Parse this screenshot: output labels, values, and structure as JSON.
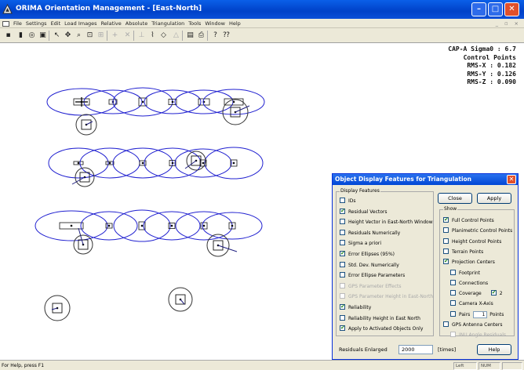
{
  "window": {
    "title": "ORIMA Orientation Management - [East-North]",
    "colors": {
      "titlebar": "#0054e3",
      "ellipse": "#2020d0",
      "vector": "#202080"
    }
  },
  "menu": [
    "File",
    "Settings",
    "Edit",
    "Load Images",
    "Relative",
    "Absolute",
    "Triangulation",
    "Tools",
    "Window",
    "Help"
  ],
  "mdi_controls": "_ ▫ ×",
  "toolbar": {
    "icons": [
      "save-icon",
      "stats-icon",
      "settings-icon",
      "frame-icon",
      "pointer-icon",
      "pan-icon",
      "zoom-icon",
      "zoom-window-icon",
      "zoom-all-icon",
      "add-point-icon",
      "delete-point-icon",
      "measure-icon",
      "relative-icon",
      "absolute-icon",
      "triangulate-icon",
      "report-icon",
      "print-icon",
      "help-icon",
      "whats-this-icon"
    ]
  },
  "stats": {
    "sigma_label": "CAP-A Sigma0 :",
    "sigma_value": "6.7",
    "heading": "Control Points",
    "rms_x_label": "RMS-X :",
    "rms_x_value": "0.182",
    "rms_y_label": "RMS-Y :",
    "rms_y_value": "0.126",
    "rms_z_label": "RMS-Z :",
    "rms_z_value": "0.090"
  },
  "dialog": {
    "title": "Object Display Features for Triangulation",
    "display_features_label": "Display Features",
    "display_features": [
      {
        "label": "IDs",
        "checked": false,
        "enabled": true
      },
      {
        "label": "Residual Vectors",
        "checked": true,
        "enabled": true
      },
      {
        "label": "Height Vector in East-North Window",
        "checked": false,
        "enabled": true
      },
      {
        "label": "Residuals Numerically",
        "checked": false,
        "enabled": true
      },
      {
        "label": "Sigma a priori",
        "checked": false,
        "enabled": true
      },
      {
        "label": "Error Ellipses (95%)",
        "checked": true,
        "enabled": true
      },
      {
        "label": "Std. Dev. Numerically",
        "checked": false,
        "enabled": true
      },
      {
        "label": "Error Ellipse Parameters",
        "checked": false,
        "enabled": true
      },
      {
        "label": "GPS Parameter Effects",
        "checked": false,
        "enabled": false
      },
      {
        "label": "GPS Parameter Height in East-North",
        "checked": false,
        "enabled": false
      },
      {
        "label": "Reliability",
        "checked": true,
        "enabled": true
      },
      {
        "label": "Reliability Height in East North",
        "checked": false,
        "enabled": true
      },
      {
        "label": "Apply to Activated Objects Only",
        "checked": true,
        "enabled": true
      }
    ],
    "close_label": "Close",
    "apply_label": "Apply",
    "show_label": "Show",
    "show_items": [
      {
        "label": "Full Control Points",
        "checked": true,
        "enabled": true
      },
      {
        "label": "Planimetric Control Points",
        "checked": false,
        "enabled": true
      },
      {
        "label": "Height Control Points",
        "checked": false,
        "enabled": true
      },
      {
        "label": "Terrain Points",
        "checked": false,
        "enabled": true
      },
      {
        "label": "Projection Centers",
        "checked": true,
        "enabled": true
      },
      {
        "label": "Footprint",
        "checked": false,
        "enabled": true
      },
      {
        "label": "Connections",
        "checked": false,
        "enabled": true
      },
      {
        "label": "Coverage",
        "checked": false,
        "enabled": true
      },
      {
        "label": "Camera X-Axis",
        "checked": false,
        "enabled": true
      },
      {
        "label": "Pairs",
        "checked": false,
        "enabled": true
      },
      {
        "label": "GPS Antenna Centers",
        "checked": false,
        "enabled": true
      },
      {
        "label": "INU Angle Residuals",
        "checked": false,
        "enabled": false
      }
    ],
    "coverage_extra_checked": true,
    "coverage_extra_value": "2",
    "pairs_value": "1",
    "pairs_suffix": "Points",
    "residuals_label": "Residuals Enlarged",
    "residuals_value": "2000",
    "times_label": "[times]",
    "help_label": "Help"
  },
  "statusbar": {
    "text": "For Help, press F1",
    "panel1": "Left",
    "panel2": "NUM"
  }
}
